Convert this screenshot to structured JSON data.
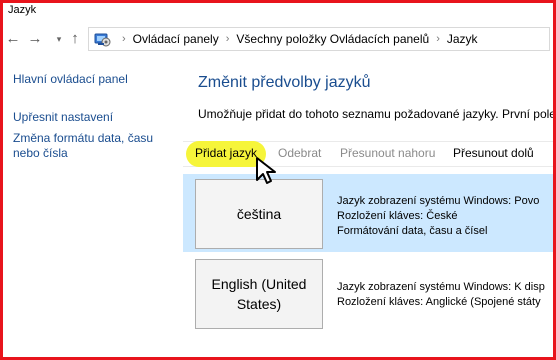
{
  "window": {
    "title": "Jazyk"
  },
  "nav": {
    "back_icon": "back-arrow-icon",
    "forward_icon": "forward-arrow-icon",
    "recent_icon": "chevron-down-icon",
    "up_icon": "up-arrow-icon"
  },
  "breadcrumb": {
    "icon": "control-panel-icon",
    "items": [
      "Ovládací panely",
      "Všechny položky Ovládacích panelů",
      "Jazyk"
    ],
    "separator": "›"
  },
  "sidebar": {
    "items": [
      {
        "label": "Hlavní ovládací panel"
      },
      {
        "label": "Upřesnit nastavení"
      },
      {
        "label": "Změna formátu data, času nebo čísla"
      }
    ]
  },
  "main": {
    "heading": "Změnit předvolby jazyků",
    "description": "Umožňuje přidat do tohoto seznamu požadované jazyky. První pole"
  },
  "toolbar": {
    "add_label": "Přidat jazyk",
    "remove_label": "Odebrat",
    "move_up_label": "Přesunout nahoru",
    "move_down_label": "Přesunout dolů",
    "highlight_color": "#f6f53a"
  },
  "languages": [
    {
      "name": "čeština",
      "selected": true,
      "lines": [
        "Jazyk zobrazení systému Windows: Povo",
        "Rozložení kláves: České",
        "Formátování data, času a čísel"
      ]
    },
    {
      "name": "English (United States)",
      "selected": false,
      "lines": [
        "Jazyk zobrazení systému Windows: K disp",
        "Rozložení kláves: Anglické (Spojené státy"
      ]
    }
  ],
  "colors": {
    "link": "#1a4d8f",
    "selection": "#cce8ff",
    "annotation_border": "#e8141c"
  }
}
